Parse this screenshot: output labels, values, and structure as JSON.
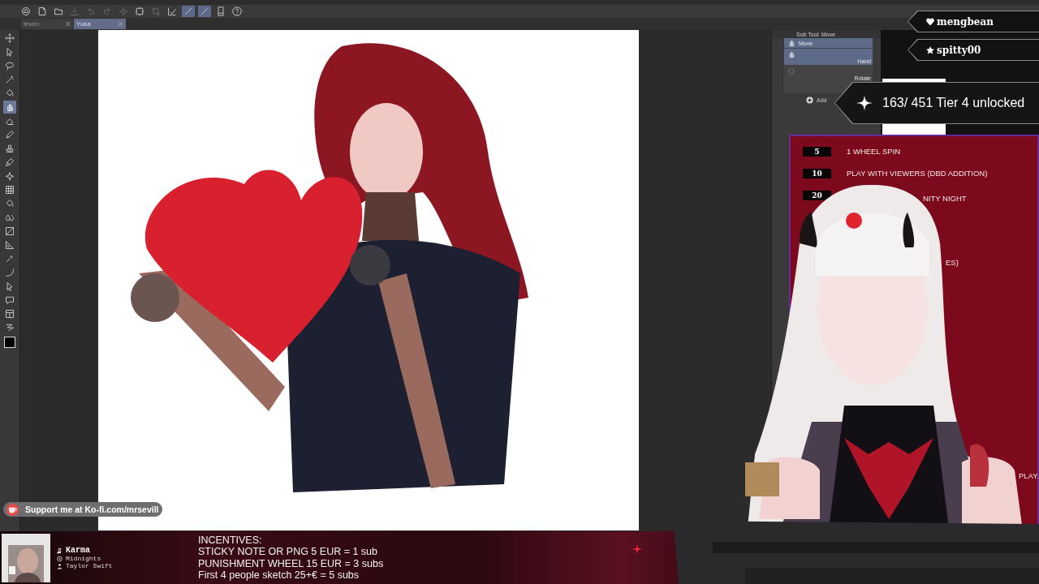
{
  "toolbar": [
    {
      "kind": "cloud",
      "selected": false,
      "disabled": false
    },
    {
      "kind": "doc",
      "selected": false,
      "disabled": false
    },
    {
      "kind": "folder",
      "selected": false,
      "disabled": false
    },
    {
      "kind": "download",
      "selected": false,
      "disabled": true
    },
    {
      "kind": "undo",
      "selected": false,
      "disabled": true
    },
    {
      "kind": "redo",
      "selected": false,
      "disabled": true
    },
    {
      "kind": "sparkle",
      "selected": false,
      "disabled": true
    },
    {
      "kind": "frame",
      "selected": false,
      "disabled": false
    },
    {
      "kind": "crop",
      "selected": false,
      "disabled": true
    },
    {
      "kind": "check",
      "selected": false,
      "disabled": false
    },
    {
      "kind": "line",
      "selected": true,
      "disabled": false
    },
    {
      "kind": "line",
      "selected": true,
      "disabled": false
    },
    {
      "kind": "device",
      "selected": false,
      "disabled": false
    },
    {
      "kind": "help",
      "selected": false,
      "disabled": false
    }
  ],
  "document_tabs": [
    {
      "label": "leven",
      "selected": false
    },
    {
      "label": "Yuka",
      "selected": true
    }
  ],
  "tools": [
    {
      "kind": "move",
      "selected": false
    },
    {
      "kind": "cursor",
      "selected": false
    },
    {
      "kind": "lasso",
      "selected": false
    },
    {
      "kind": "wand",
      "selected": false
    },
    {
      "kind": "bucket",
      "selected": false
    },
    {
      "kind": "hand",
      "selected": true
    },
    {
      "kind": "eraser",
      "selected": false
    },
    {
      "kind": "pen",
      "selected": false
    },
    {
      "kind": "stamp",
      "selected": false
    },
    {
      "kind": "brush",
      "selected": false
    },
    {
      "kind": "sparkle",
      "selected": false
    },
    {
      "kind": "grid",
      "selected": false
    },
    {
      "kind": "bucket",
      "selected": false
    },
    {
      "kind": "drops",
      "selected": false
    },
    {
      "kind": "gradient",
      "selected": false
    },
    {
      "kind": "ruler",
      "selected": false
    },
    {
      "kind": "eyedropper",
      "selected": false
    },
    {
      "kind": "curve",
      "selected": false
    },
    {
      "kind": "cursor",
      "selected": false
    },
    {
      "kind": "balloon",
      "selected": false
    },
    {
      "kind": "panel",
      "selected": false
    },
    {
      "kind": "zigzag",
      "selected": false
    }
  ],
  "sub_tool_panel": {
    "title": "Sub Tool: Move",
    "items": [
      {
        "label": "Move",
        "selected": true
      },
      {
        "label": "Hand",
        "selected": true
      },
      {
        "label": "Rotate",
        "selected": false
      }
    ],
    "add_label": "Add"
  },
  "alerts": [
    {
      "kind": "heart",
      "name": "mengbean"
    },
    {
      "kind": "star",
      "name": "spitty00"
    }
  ],
  "goal": {
    "text": "163/ 451 Tier 4 unlocked"
  },
  "incentive_panel": {
    "rows": [
      {
        "amount": "5",
        "text": "1 WHEEL SPIN"
      },
      {
        "amount": "10",
        "text": "PLAY WITH VIEWERS (DBD ADDITION)"
      },
      {
        "amount": "20",
        "text": "NITY NIGHT"
      },
      {
        "text": "ES)"
      },
      {
        "text": "PLAY."
      }
    ]
  },
  "kofi": {
    "text": "Support me at Ko-fi.com/mrsevill"
  },
  "now_playing": {
    "title": "Karma",
    "album": "Midnights",
    "artist": "Taylor Swift"
  },
  "incentives": [
    "INCENTIVES:",
    "STICKY NOTE OR PNG 5 EUR = 1 sub",
    "PUNISHMENT WHEEL 15 EUR = 3 subs",
    "First 4 people sketch 25+€ = 5 subs"
  ]
}
